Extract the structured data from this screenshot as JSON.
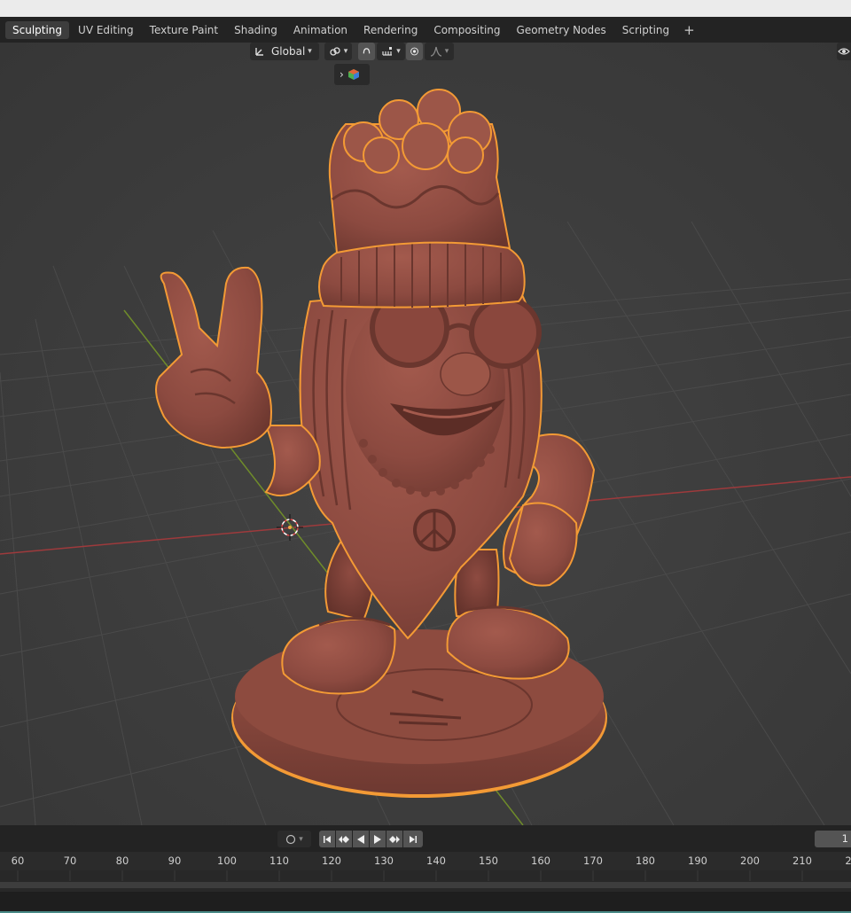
{
  "workspace_tabs": [
    {
      "label": "Sculpting",
      "active": true
    },
    {
      "label": "UV Editing",
      "active": false
    },
    {
      "label": "Texture Paint",
      "active": false
    },
    {
      "label": "Shading",
      "active": false
    },
    {
      "label": "Animation",
      "active": false
    },
    {
      "label": "Rendering",
      "active": false
    },
    {
      "label": "Compositing",
      "active": false
    },
    {
      "label": "Geometry Nodes",
      "active": false
    },
    {
      "label": "Scripting",
      "active": false
    }
  ],
  "add_workspace_label": "+",
  "viewport_header": {
    "transform_orientation": "Global",
    "icons": [
      "orientation-icon",
      "snap-link-icon",
      "proportional-edit-icon",
      "snap-increment-icon",
      "proportional-falloff-icon",
      "falloff-curve-icon"
    ]
  },
  "viewport": {
    "object": "sculpted figure",
    "mesh_color": "#8c4a40",
    "outline_color": "#f39a35",
    "grid_color": "#464646",
    "x_axis_color": "#9e3a3c",
    "y_axis_color": "#6f8c2a"
  },
  "timeline": {
    "ticks": [
      "60",
      "70",
      "80",
      "90",
      "100",
      "110",
      "120",
      "130",
      "140",
      "150",
      "160",
      "170",
      "180",
      "190",
      "200",
      "210",
      "2"
    ],
    "current_frame": "1",
    "playback_icons": [
      "jump-start-icon",
      "prev-keyframe-icon",
      "play-reverse-icon",
      "play-icon",
      "next-keyframe-icon",
      "jump-end-icon"
    ]
  }
}
